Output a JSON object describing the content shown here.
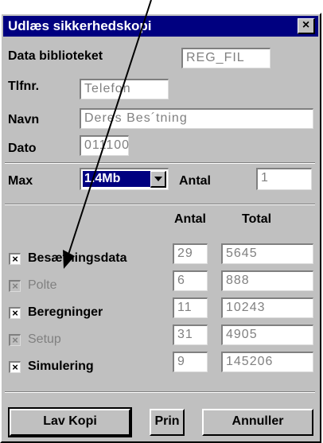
{
  "window": {
    "title": "Udlæs sikkerhedskopi",
    "close_glyph": "×"
  },
  "fields": {
    "data_bibliotek": {
      "label": "Data biblioteket",
      "value": "REG_FIL"
    },
    "tlfnr": {
      "label": "Tlfnr.",
      "value": "Telefon"
    },
    "navn": {
      "label": "Navn",
      "value": "Deres Bes´tning"
    },
    "dato": {
      "label": "Dato",
      "value": "011100"
    }
  },
  "size": {
    "max_label": "Max",
    "max_value": "1.4Mb",
    "antal_label": "Antal",
    "antal_value": "1"
  },
  "table": {
    "col_antal": "Antal",
    "col_total": "Total",
    "rows": [
      {
        "label": "Besætningsdata",
        "checked": true,
        "enabled": true,
        "antal": "29",
        "total": "5645"
      },
      {
        "label": "Polte",
        "checked": true,
        "enabled": false,
        "antal": "6",
        "total": "888"
      },
      {
        "label": "Beregninger",
        "checked": true,
        "enabled": true,
        "antal": "11",
        "total": "10243"
      },
      {
        "label": "Setup",
        "checked": true,
        "enabled": false,
        "antal": "31",
        "total": "4905"
      },
      {
        "label": "Simulering",
        "checked": true,
        "enabled": true,
        "antal": "9",
        "total": "145206"
      }
    ]
  },
  "buttons": {
    "lav_kopi": "Lav Kopi",
    "print": "Prin",
    "annuller": "Annuller"
  },
  "check_glyph": "×",
  "colors": {
    "titlebar": "#000080",
    "face": "#c0c0c0",
    "selection": "#000080",
    "disabled_text": "#808080"
  },
  "icons": {
    "combo_arrow": "chevron-down-icon"
  }
}
